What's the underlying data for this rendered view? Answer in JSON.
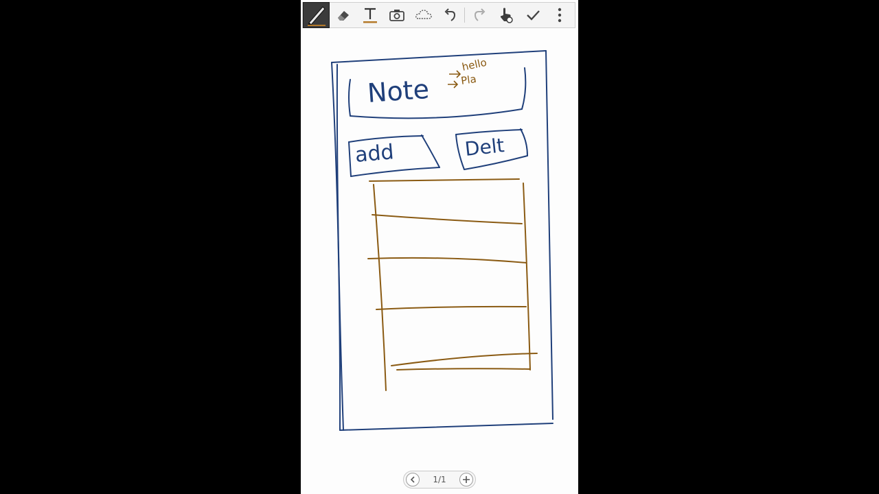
{
  "toolbar": {
    "tools": [
      {
        "name": "pen-tool",
        "icon": "pen-icon",
        "selected": true
      },
      {
        "name": "eraser-tool",
        "icon": "eraser-icon"
      },
      {
        "name": "text-tool",
        "icon": "text-icon"
      },
      {
        "name": "image-tool",
        "icon": "camera-icon"
      },
      {
        "name": "selection-tool",
        "icon": "lasso-icon"
      },
      {
        "name": "undo-button",
        "icon": "undo-icon"
      },
      {
        "name": "redo-button",
        "icon": "redo-icon"
      },
      {
        "name": "hand-tool",
        "icon": "hand-pointer-icon"
      },
      {
        "name": "done-button",
        "icon": "checkmark-icon"
      },
      {
        "name": "more-button",
        "icon": "more-vertical-icon"
      }
    ]
  },
  "sketch": {
    "title_text": "Note",
    "annotation_lines": [
      "hello",
      "Pla"
    ],
    "button_left": "add",
    "button_right": "Delt"
  },
  "pager": {
    "page_indicator": "1/1"
  },
  "colors": {
    "toolbar_bg": "#f4f4f4",
    "ink_blue": "#1f3f7a",
    "ink_brown": "#8a5a12",
    "canvas_bg": "#fdfdfd"
  }
}
